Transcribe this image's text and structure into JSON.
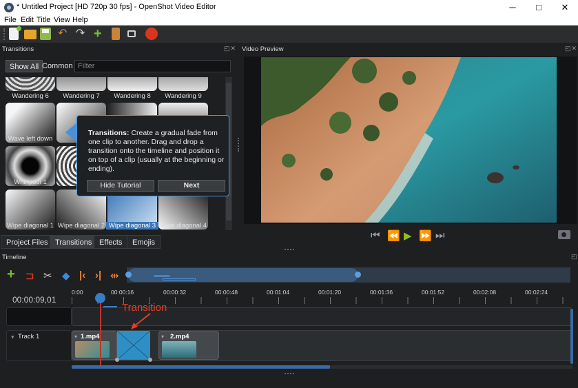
{
  "window": {
    "title": "* Untitled Project [HD 720p 30 fps] - OpenShot Video Editor",
    "app_icon": "openshot-icon",
    "controls": [
      "minimize-icon",
      "maximize-icon",
      "close-icon"
    ],
    "control_glyphs": {
      "minimize": "─",
      "maximize": "□",
      "close": "✕"
    }
  },
  "menu": [
    "File",
    "Edit",
    "Title",
    "View",
    "Help"
  ],
  "toolbar": {
    "icons": [
      "new-project-icon",
      "open-project-icon",
      "save-project-icon",
      "undo-icon",
      "redo-icon",
      "import-files-icon",
      "choose-profile-icon",
      "fullscreen-icon",
      "export-video-icon"
    ]
  },
  "transitions_panel": {
    "title": "Transitions",
    "filters": [
      "Show All",
      "Common"
    ],
    "active_filter": "Show All",
    "filter_placeholder": "Filter",
    "items": [
      {
        "label": "Wandering 6"
      },
      {
        "label": "Wandering 7"
      },
      {
        "label": "Wandering 8"
      },
      {
        "label": "Wandering 9"
      },
      {
        "label": "Wave left down"
      },
      {
        "label": "Wa"
      },
      {
        "label": ""
      },
      {
        "label": ""
      },
      {
        "label": "Whirlpool 1"
      },
      {
        "label": "Whi"
      },
      {
        "label": ""
      },
      {
        "label": ""
      },
      {
        "label": "Wipe diagonal 1"
      },
      {
        "label": "Wipe diagonal 2"
      },
      {
        "label": "Wipe diagonal 3",
        "selected": true
      },
      {
        "label": "Wipe diagonal 4"
      }
    ]
  },
  "tutorial": {
    "heading": "Transitions:",
    "body": "Create a gradual fade from one clip to another. Drag and drop a transition onto the timeline and position it on top of a clip (usually at the beginning or ending).",
    "hide_button": "Hide Tutorial",
    "next_button": "Next"
  },
  "bottom_tabs": [
    "Project Files",
    "Transitions",
    "Effects",
    "Emojis"
  ],
  "active_tab": "Transitions",
  "video_preview": {
    "title": "Video Preview",
    "controls": [
      "jump-to-start-icon",
      "rewind-icon",
      "play-icon",
      "fast-forward-icon",
      "jump-to-end-icon"
    ],
    "control_glyphs": [
      "⏮",
      "⏪",
      "▶",
      "⏩",
      "⏭"
    ],
    "snapshot_icon": "camera-icon"
  },
  "timeline": {
    "title": "Timeline",
    "toolbar_icons": [
      "add-track-icon",
      "snapping-icon",
      "razor-icon",
      "add-marker-icon",
      "previous-marker-icon",
      "next-marker-icon",
      "center-playhead-icon"
    ],
    "timecode": "00:00:09,01",
    "ruler": [
      "0:00",
      "00:00:16",
      "00:00:32",
      "00:00:48",
      "00:01:04",
      "00:01:20",
      "00:01:36",
      "00:01:52",
      "00:02:08",
      "00:02:24"
    ],
    "track_name": "Track 1",
    "clips": [
      "1.mp4",
      "2.mp4"
    ],
    "annotation": "Transition"
  },
  "colors": {
    "accent": "#3b76b7",
    "transition_clip": "#2f8fc4",
    "annotation": "#e0402e",
    "play_button": "#8dc21f"
  }
}
